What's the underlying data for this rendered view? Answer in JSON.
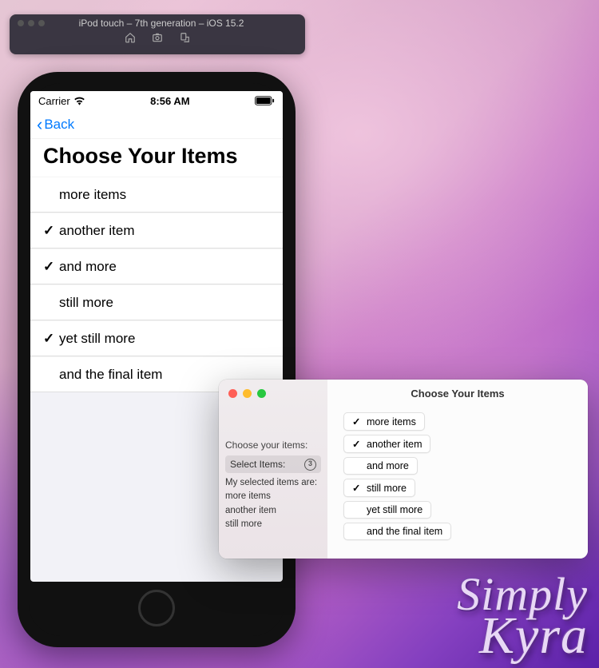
{
  "simulator": {
    "title": "iPod touch – 7th generation – iOS 15.2",
    "icons": [
      "home-icon",
      "screenshot-icon",
      "rotate-icon"
    ]
  },
  "phone": {
    "status": {
      "carrier": "Carrier",
      "time": "8:56 AM"
    },
    "nav": {
      "back_label": "Back"
    },
    "title": "Choose Your Items",
    "items": [
      {
        "label": "more items",
        "checked": false
      },
      {
        "label": "another item",
        "checked": true
      },
      {
        "label": "and more",
        "checked": true
      },
      {
        "label": "still more",
        "checked": false
      },
      {
        "label": "yet still more",
        "checked": true
      },
      {
        "label": "and the final item",
        "checked": false
      }
    ]
  },
  "mac": {
    "title": "Choose Your Items",
    "sidebar": {
      "choose_label": "Choose your items:",
      "select_label": "Select Items:",
      "count": "3",
      "results_heading": "My selected items are:",
      "results": [
        "more items",
        "another item",
        "still more"
      ]
    },
    "items": [
      {
        "label": "more items",
        "checked": true
      },
      {
        "label": "another item",
        "checked": true
      },
      {
        "label": "and more",
        "checked": false
      },
      {
        "label": "still more",
        "checked": true
      },
      {
        "label": "yet still more",
        "checked": false
      },
      {
        "label": "and the final item",
        "checked": false
      }
    ]
  },
  "watermark": {
    "line1": "Simply",
    "line2": "Kyra"
  },
  "glyphs": {
    "check": "✓",
    "chevron_left": "‹"
  }
}
